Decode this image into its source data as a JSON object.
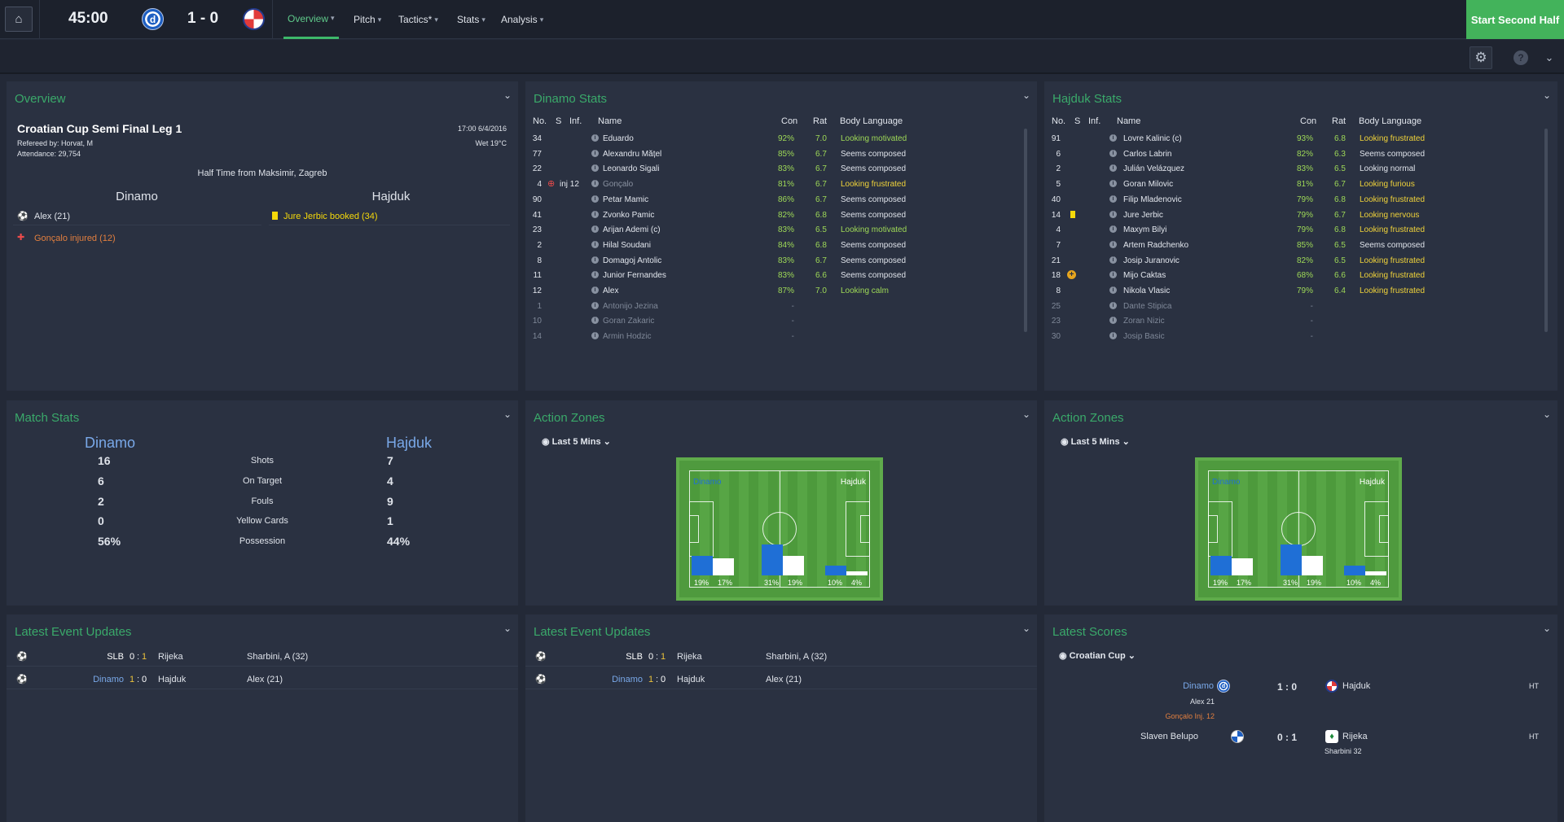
{
  "header": {
    "clock": "45:00",
    "score": "1 - 0",
    "home_crest": "dinamo-crest",
    "away_crest": "hajduk-crest",
    "nav": [
      "Overview",
      "Pitch",
      "Tactics*",
      "Stats",
      "Analysis"
    ],
    "start_button": "Start Second Half"
  },
  "overview": {
    "title": "Overview",
    "competition": "Croatian Cup Semi Final Leg 1",
    "referee": "Refereed by: Horvat, M",
    "attendance": "Attendance: 29,754",
    "time": "17:00 6/4/2016",
    "weather": "Wet 19°C",
    "status": "Half Time from Maksimir, Zagreb",
    "home": "Dinamo",
    "away": "Hajduk",
    "home_events": [
      "Alex (21)",
      "Gonçalo injured (12)"
    ],
    "away_events": [
      "Jure Jerbic booked (34)"
    ]
  },
  "stats_headers": {
    "no": "No.",
    "s": "S",
    "inf": "Inf.",
    "name": "Name",
    "con": "Con",
    "rat": "Rat",
    "body": "Body Language"
  },
  "dinamo_stats": {
    "title": "Dinamo Stats",
    "players": [
      {
        "no": "34",
        "inf": "",
        "name": "Eduardo",
        "con": "92%",
        "rat": "7.0",
        "body": "Looking motivated",
        "tone": "green"
      },
      {
        "no": "77",
        "inf": "",
        "name": "Alexandru Mățel",
        "con": "85%",
        "rat": "6.7",
        "body": "Seems composed",
        "tone": "white"
      },
      {
        "no": "22",
        "inf": "",
        "name": "Leonardo Sigali",
        "con": "83%",
        "rat": "6.7",
        "body": "Seems composed",
        "tone": "white"
      },
      {
        "no": "4",
        "inf": "inj 12",
        "name": "Gonçalo",
        "con": "81%",
        "rat": "6.7",
        "body": "Looking frustrated",
        "tone": "yellow",
        "dim": true
      },
      {
        "no": "90",
        "inf": "",
        "name": "Petar Mamic",
        "con": "86%",
        "rat": "6.7",
        "body": "Seems composed",
        "tone": "white"
      },
      {
        "no": "41",
        "inf": "",
        "name": "Zvonko Pamic",
        "con": "82%",
        "rat": "6.8",
        "body": "Seems composed",
        "tone": "white"
      },
      {
        "no": "23",
        "inf": "",
        "name": "Arijan Ademi (c)",
        "con": "83%",
        "rat": "6.5",
        "body": "Looking motivated",
        "tone": "green"
      },
      {
        "no": "2",
        "inf": "",
        "name": "Hilal Soudani",
        "con": "84%",
        "rat": "6.8",
        "body": "Seems composed",
        "tone": "white"
      },
      {
        "no": "8",
        "inf": "",
        "name": "Domagoj Antolic",
        "con": "83%",
        "rat": "6.7",
        "body": "Seems composed",
        "tone": "white"
      },
      {
        "no": "11",
        "inf": "",
        "name": "Junior Fernandes",
        "con": "83%",
        "rat": "6.6",
        "body": "Seems composed",
        "tone": "white"
      },
      {
        "no": "12",
        "inf": "",
        "name": "Alex",
        "con": "87%",
        "rat": "7.0",
        "body": "Looking calm",
        "tone": "green"
      },
      {
        "no": "1",
        "inf": "",
        "name": "Antonijo Jezina",
        "con": "-",
        "rat": "",
        "body": "",
        "bench": true
      },
      {
        "no": "10",
        "inf": "",
        "name": "Goran Zakaric",
        "con": "-",
        "rat": "",
        "body": "",
        "bench": true
      },
      {
        "no": "14",
        "inf": "",
        "name": "Armin Hodzic",
        "con": "-",
        "rat": "",
        "body": "",
        "bench": true
      }
    ]
  },
  "hajduk_stats": {
    "title": "Hajduk Stats",
    "players": [
      {
        "no": "91",
        "name": "Lovre Kalinic (c)",
        "con": "93%",
        "rat": "6.8",
        "body": "Looking frustrated",
        "tone": "yellow"
      },
      {
        "no": "6",
        "name": "Carlos Labrin",
        "con": "82%",
        "rat": "6.3",
        "body": "Seems composed",
        "tone": "white"
      },
      {
        "no": "2",
        "name": "Julián Velázquez",
        "con": "83%",
        "rat": "6.5",
        "body": "Looking normal",
        "tone": "white"
      },
      {
        "no": "5",
        "name": "Goran Milovic",
        "con": "81%",
        "rat": "6.7",
        "body": "Looking furious",
        "tone": "yellow"
      },
      {
        "no": "40",
        "name": "Filip Mladenovic",
        "con": "79%",
        "rat": "6.8",
        "body": "Looking frustrated",
        "tone": "yellow"
      },
      {
        "no": "14",
        "name": "Jure Jerbic",
        "con": "79%",
        "rat": "6.7",
        "body": "Looking nervous",
        "tone": "yellow",
        "card": true
      },
      {
        "no": "4",
        "name": "Maxym Bilyi",
        "con": "79%",
        "rat": "6.8",
        "body": "Looking frustrated",
        "tone": "yellow"
      },
      {
        "no": "7",
        "name": "Artem Radchenko",
        "con": "85%",
        "rat": "6.5",
        "body": "Seems composed",
        "tone": "white"
      },
      {
        "no": "21",
        "name": "Josip Juranovic",
        "con": "82%",
        "rat": "6.5",
        "body": "Looking frustrated",
        "tone": "yellow"
      },
      {
        "no": "18",
        "name": "Mijo Caktas",
        "con": "68%",
        "rat": "6.6",
        "body": "Looking frustrated",
        "tone": "yellow",
        "plus": true
      },
      {
        "no": "8",
        "name": "Nikola Vlasic",
        "con": "79%",
        "rat": "6.4",
        "body": "Looking frustrated",
        "tone": "yellow"
      },
      {
        "no": "25",
        "name": "Dante Stipica",
        "con": "-",
        "rat": "",
        "body": "",
        "bench": true
      },
      {
        "no": "23",
        "name": "Zoran Nizic",
        "con": "-",
        "rat": "",
        "body": "",
        "bench": true
      },
      {
        "no": "30",
        "name": "Josip Basic",
        "con": "-",
        "rat": "",
        "body": "",
        "bench": true
      }
    ]
  },
  "match_stats": {
    "title": "Match Stats",
    "home": "Dinamo",
    "away": "Hajduk",
    "rows": [
      {
        "label": "Shots",
        "home": "16",
        "away": "7"
      },
      {
        "label": "On Target",
        "home": "6",
        "away": "4"
      },
      {
        "label": "Fouls",
        "home": "2",
        "away": "9"
      },
      {
        "label": "Yellow Cards",
        "home": "0",
        "away": "1"
      },
      {
        "label": "Possession",
        "home": "56%",
        "away": "44%"
      }
    ]
  },
  "action_zones": {
    "title": "Action Zones",
    "filter": "Last 5 Mins",
    "home_label": "Dinamo",
    "away_label": "Hajduk",
    "zones": [
      {
        "home": 19,
        "away": 17,
        "home_label": "19%",
        "away_label": "17%"
      },
      {
        "home": 31,
        "away": 19,
        "home_label": "31%",
        "away_label": "19%"
      },
      {
        "home": 10,
        "away": 4,
        "home_label": "10%",
        "away_label": "4%"
      }
    ],
    "colors": {
      "home": "#1f6fd6",
      "away": "#ffffff"
    }
  },
  "latest_events": {
    "title": "Latest Event Updates",
    "rows": [
      {
        "home": "SLB",
        "hs": "0",
        "as": "1",
        "away": "Rijeka",
        "scorer": "Sharbini, A (32)"
      },
      {
        "home": "Dinamo",
        "hs": "1",
        "as": "0",
        "away": "Hajduk",
        "scorer": "Alex (21)"
      }
    ]
  },
  "latest_scores": {
    "title": "Latest Scores",
    "filter": "Croatian Cup",
    "matches": [
      {
        "home": "Dinamo",
        "score": "1 : 0",
        "away": "Hajduk",
        "status": "HT",
        "home_scorer": "Alex 21",
        "note": "Gonçalo Inj. 12"
      },
      {
        "home": "Slaven Belupo",
        "score": "0 : 1",
        "away": "Rijeka",
        "status": "HT",
        "away_scorer": "Sharbini 32"
      }
    ]
  }
}
